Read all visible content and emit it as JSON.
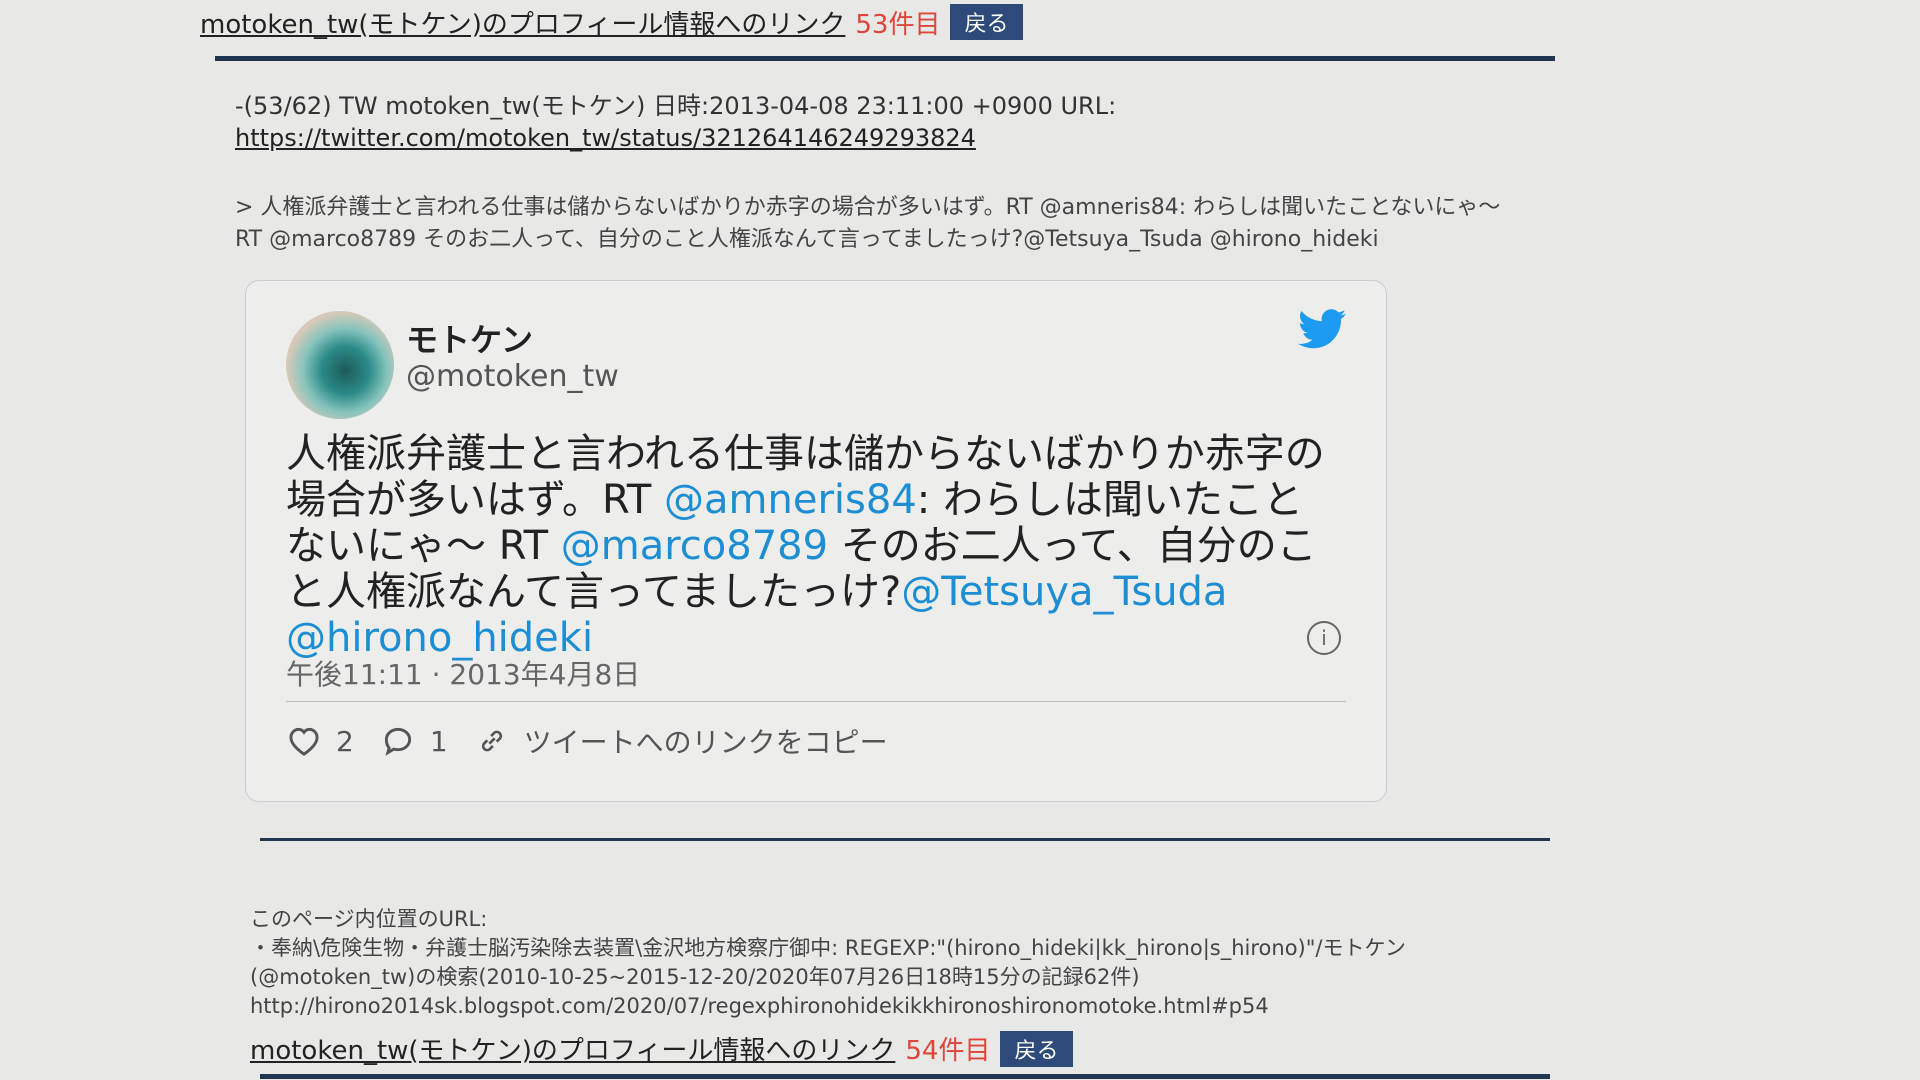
{
  "header": {
    "profile_link": "motoken_tw(モトケン)のプロフィール情報へのリンク",
    "count": "53件目",
    "back_label": "戻る"
  },
  "entry": {
    "meta": "-(53/62) TW motoken_tw(モトケン) 日時:2013-04-08 23:11:00 +0900 URL:",
    "url": "https://twitter.com/motoken_tw/status/321264146249293824",
    "quote_line1": "> 人権派弁護士と言われる仕事は儲からないばかりか赤字の場合が多いはず。RT @amneris84: わらしは聞いたことないにゃ〜",
    "quote_line2": "RT @marco8789 そのお二人って、自分のこと人権派なんて言ってましたっけ?@Tetsuya_Tsuda @hirono_hideki"
  },
  "tweet": {
    "name": "モトケン",
    "handle": "@motoken_tw",
    "text_part1": "人権派弁護士と言われる仕事は儲からないばかりか赤字の場合が多いはず。RT ",
    "mention1": "@amneris84",
    "text_part2": ": わらしは聞いたことないにゃ〜 RT ",
    "mention2": "@marco8789",
    "text_part3": " そのお二人って、自分のこと人権派なんて言ってましたっけ?",
    "mention3": "@Tetsuya_Tsuda",
    "mention4": "@hirono_hideki",
    "time": "午後11:11 · 2013年4月8日",
    "likes": "2",
    "replies": "1",
    "copy_link": "ツイートへのリンクをコピー",
    "brand_color": "#1d9bf0"
  },
  "footer": {
    "line1": "このページ内位置のURL:",
    "line2": "・奉納\\危険生物・弁護士脳汚染除去装置\\金沢地方検察庁御中: REGEXP:\"(hirono_hideki|kk_hirono|s_hirono)\"/モトケン",
    "line3": "(@motoken_tw)の検索(2010-10-25~2015-12-20/2020年07月26日18時15分の記録62件)",
    "line4": "http://hirono2014sk.blogspot.com/2020/07/regexphironohidekikkhironoshironomotoke.html#p54",
    "profile_link": "motoken_tw(モトケン)のプロフィール情報へのリンク",
    "count": "54件目",
    "back_label": "戻る"
  }
}
